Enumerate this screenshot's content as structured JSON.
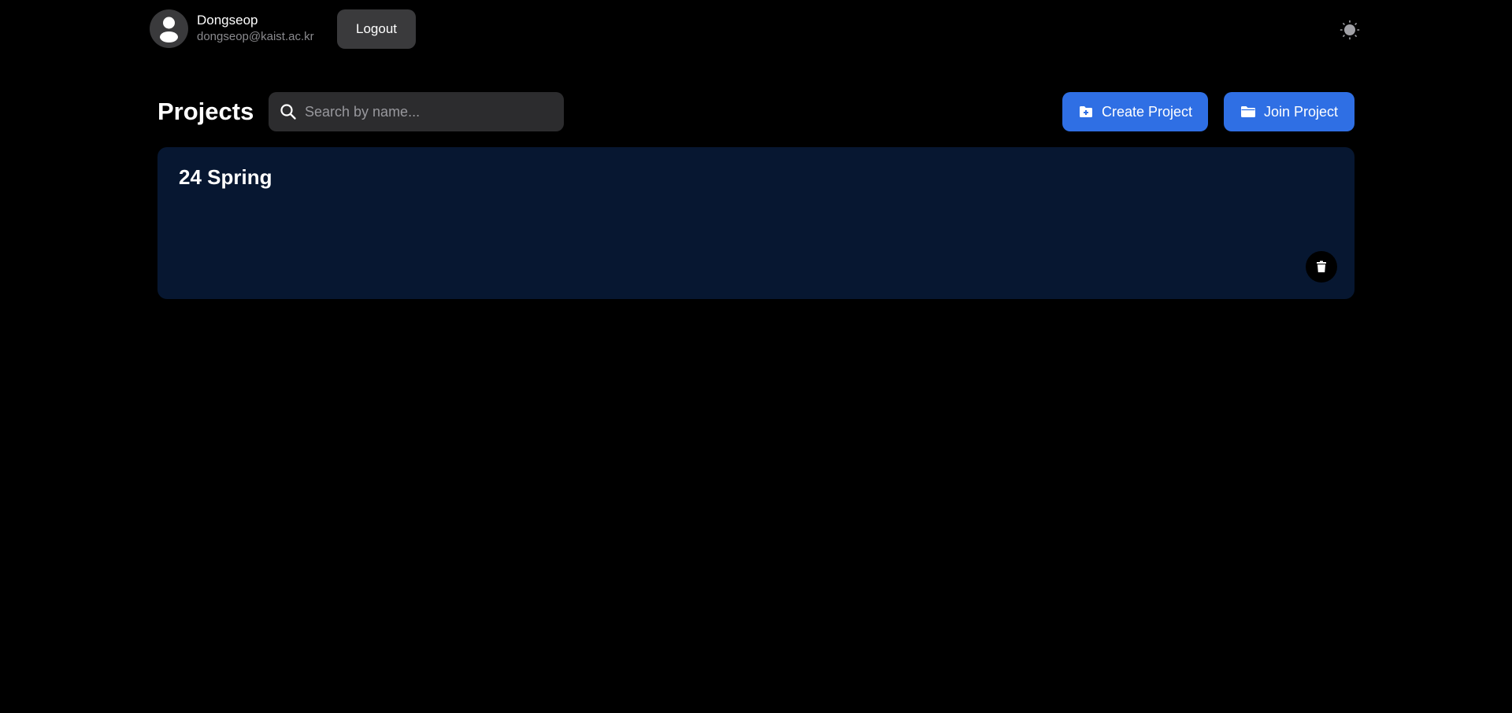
{
  "user": {
    "name": "Dongseop",
    "email": "dongseop@kaist.ac.kr",
    "avatar_icon": "user-silhouette-icon"
  },
  "header": {
    "logout_label": "Logout",
    "theme_toggle_icon": "sun-icon"
  },
  "toolbar": {
    "title": "Projects",
    "search": {
      "placeholder": "Search by name...",
      "value": "",
      "icon": "search-icon"
    },
    "create_label": "Create Project",
    "create_icon": "folder-plus-icon",
    "join_label": "Join Project",
    "join_icon": "folder-icon"
  },
  "projects": [
    {
      "name": "24 Spring",
      "delete_icon": "trash-icon"
    }
  ],
  "colors": {
    "background": "#000000",
    "accent": "#2f6fe4",
    "card": "#071731",
    "secondary_button": "#3a3a3c",
    "search_bg": "#2c2c2e",
    "muted_text": "#8a8a8e"
  }
}
